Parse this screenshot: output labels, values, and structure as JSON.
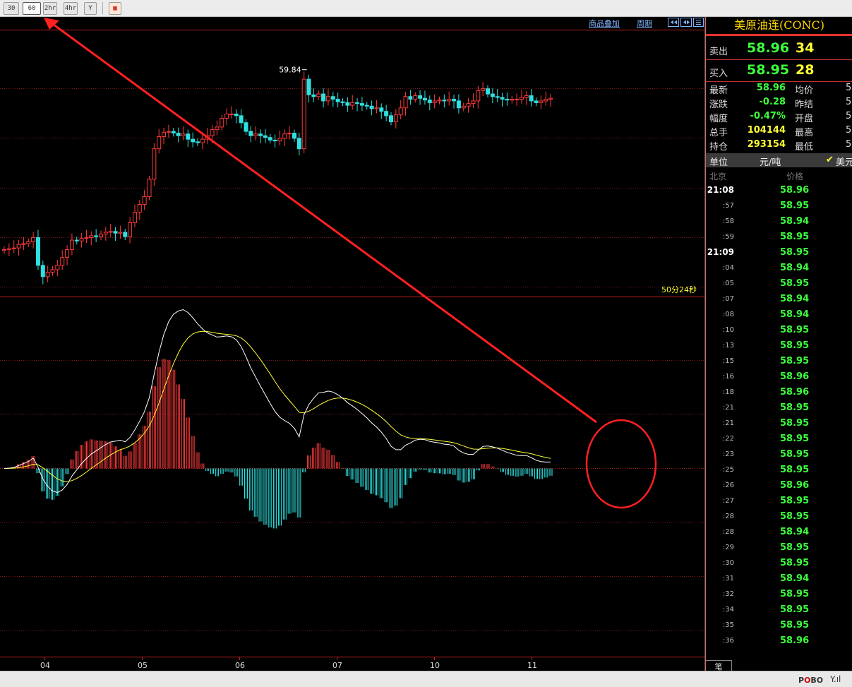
{
  "toolbar": {
    "buttons": [
      "30",
      "60",
      "2hr",
      "4hr",
      "Y"
    ],
    "active": "60",
    "extra_icon": "calendar-icon"
  },
  "chart_links": {
    "overlay": "商品叠加",
    "period": "周期"
  },
  "symbol": "美原油连(CONC)",
  "quote": {
    "sell_label": "卖出",
    "sell_price": "58.96",
    "sell_vol": "34",
    "buy_label": "买入",
    "buy_price": "58.95",
    "buy_vol": "28"
  },
  "stats": [
    {
      "label": "最新",
      "value": "58.96",
      "label2": "均价",
      "value2": "5"
    },
    {
      "label": "涨跌",
      "value": "-0.28",
      "label2": "昨结",
      "value2": "5"
    },
    {
      "label": "幅度",
      "value": "-0.47%",
      "label2": "开盘",
      "value2": "5"
    },
    {
      "label": "总手",
      "value": "104144",
      "label2": "最高",
      "value2": "5"
    },
    {
      "label": "持仓",
      "value": "293154",
      "label2": "最低",
      "value2": "5"
    }
  ],
  "unit": {
    "label": "单位",
    "value": "元/吨",
    "currency": "美元"
  },
  "ticks_header": {
    "time": "北京",
    "price": "价格"
  },
  "ticks": [
    {
      "t": "21:08",
      "p": "58.96"
    },
    {
      "t": ":57",
      "p": "58.95"
    },
    {
      "t": ":58",
      "p": "58.94"
    },
    {
      "t": ":59",
      "p": "58.95"
    },
    {
      "t": "21:09",
      "p": "58.95"
    },
    {
      "t": ":04",
      "p": "58.94"
    },
    {
      "t": ":05",
      "p": "58.95"
    },
    {
      "t": ":07",
      "p": "58.94"
    },
    {
      "t": ":08",
      "p": "58.94"
    },
    {
      "t": ":10",
      "p": "58.95"
    },
    {
      "t": ":13",
      "p": "58.95"
    },
    {
      "t": ":15",
      "p": "58.95"
    },
    {
      "t": ":16",
      "p": "58.96"
    },
    {
      "t": ":18",
      "p": "58.96"
    },
    {
      "t": ":21",
      "p": "58.95"
    },
    {
      "t": ":21",
      "p": "58.95"
    },
    {
      "t": ":22",
      "p": "58.95"
    },
    {
      "t": ":23",
      "p": "58.95"
    },
    {
      "t": ":25",
      "p": "58.95"
    },
    {
      "t": ":26",
      "p": "58.96"
    },
    {
      "t": ":27",
      "p": "58.95"
    },
    {
      "t": ":28",
      "p": "58.95"
    },
    {
      "t": ":28",
      "p": "58.94"
    },
    {
      "t": ":29",
      "p": "58.95"
    },
    {
      "t": ":30",
      "p": "58.95"
    },
    {
      "t": ":31",
      "p": "58.94"
    },
    {
      "t": ":32",
      "p": "58.95"
    },
    {
      "t": ":34",
      "p": "58.95"
    },
    {
      "t": ":35",
      "p": "58.95"
    },
    {
      "t": ":36",
      "p": "58.96"
    }
  ],
  "bottom_tab": "笔",
  "status": {
    "logo_a": "P",
    "logo_b": "O",
    "logo_c": "BO"
  },
  "chart_data": {
    "type": "candlestick",
    "price_label": "59.84",
    "countdown": "50分24秒",
    "x_ticks": [
      "04",
      "05",
      "06",
      "07",
      "10",
      "11"
    ],
    "ylim": [
      57.3,
      60.1
    ],
    "bull_color": "#ff3a3a",
    "bear_color": "#2fe0e0",
    "closes": [
      57.79,
      57.8,
      57.81,
      57.85,
      57.86,
      57.88,
      57.93,
      57.61,
      57.48,
      57.53,
      57.56,
      57.61,
      57.7,
      57.79,
      57.9,
      57.89,
      57.92,
      57.93,
      57.95,
      57.94,
      57.97,
      57.99,
      58.0,
      57.98,
      57.99,
      57.94,
      58.1,
      58.22,
      58.31,
      58.4,
      58.6,
      58.95,
      59.09,
      59.14,
      59.15,
      59.13,
      59.1,
      59.12,
      59.06,
      59.03,
      59.02,
      59.06,
      59.1,
      59.17,
      59.2,
      59.3,
      59.35,
      59.35,
      59.33,
      59.25,
      59.15,
      59.1,
      59.12,
      59.1,
      59.08,
      59.05,
      59.04,
      59.07,
      59.12,
      59.13,
      59.07,
      58.95,
      59.75,
      59.57,
      59.55,
      59.58,
      59.5,
      59.55,
      59.52,
      59.49,
      59.48,
      59.45,
      59.48,
      59.47,
      59.45,
      59.44,
      59.41,
      59.42,
      59.38,
      59.33,
      59.26,
      59.34,
      59.42,
      59.55,
      59.52,
      59.56,
      59.53,
      59.51,
      59.48,
      59.5,
      59.51,
      59.5,
      59.52,
      59.5,
      59.42,
      59.44,
      59.47,
      59.5,
      59.62,
      59.64,
      59.58,
      59.55,
      59.54,
      59.52,
      59.51,
      59.52,
      59.52,
      59.54,
      59.56,
      59.5,
      59.48,
      59.5,
      59.52,
      59.53
    ],
    "macd_series": [
      {
        "name": "DIFF",
        "color": "#ffffff"
      },
      {
        "name": "DEA",
        "color": "#ffff33"
      }
    ]
  }
}
